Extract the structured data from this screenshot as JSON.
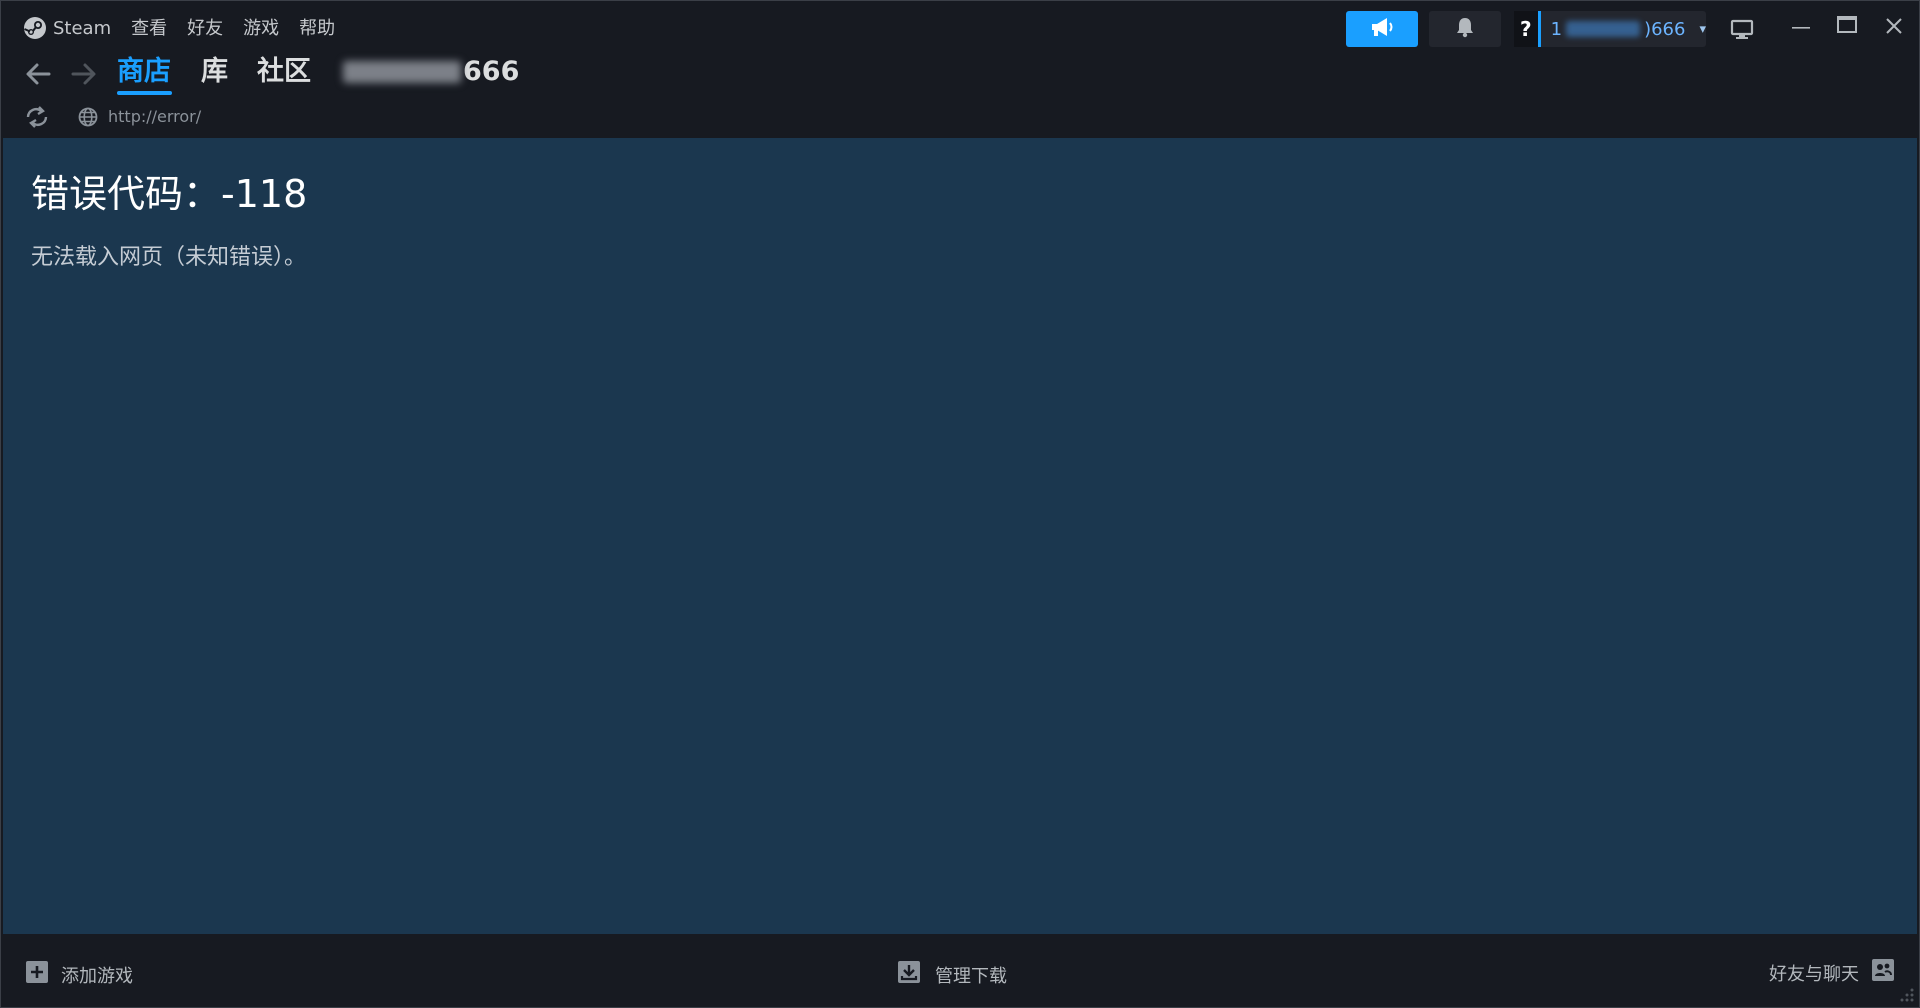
{
  "menubar": {
    "items": [
      "Steam",
      "查看",
      "好友",
      "游戏",
      "帮助"
    ]
  },
  "account": {
    "help_label": "?",
    "name_prefix": "1",
    "name_suffix": ")666"
  },
  "nav": {
    "tabs": [
      "商店",
      "库",
      "社区"
    ],
    "user_suffix": "666"
  },
  "url": "http://error/",
  "error": {
    "title": "错误代码：-118",
    "message": "无法载入网页（未知错误）。"
  },
  "bottom": {
    "add_game": "添加游戏",
    "manage_downloads": "管理下载",
    "friends_chat": "好友与聊天"
  },
  "colors": {
    "accent": "#1a9fff",
    "content_bg": "#1b374f",
    "chrome_bg": "#171a21"
  },
  "icons": [
    "steam-logo-icon",
    "megaphone-icon",
    "bell-icon",
    "monitor-icon",
    "minimize-icon",
    "maximize-icon",
    "close-icon",
    "back-arrow-icon",
    "forward-arrow-icon",
    "reload-icon",
    "globe-icon",
    "plus-icon",
    "download-icon",
    "friends-icon"
  ]
}
